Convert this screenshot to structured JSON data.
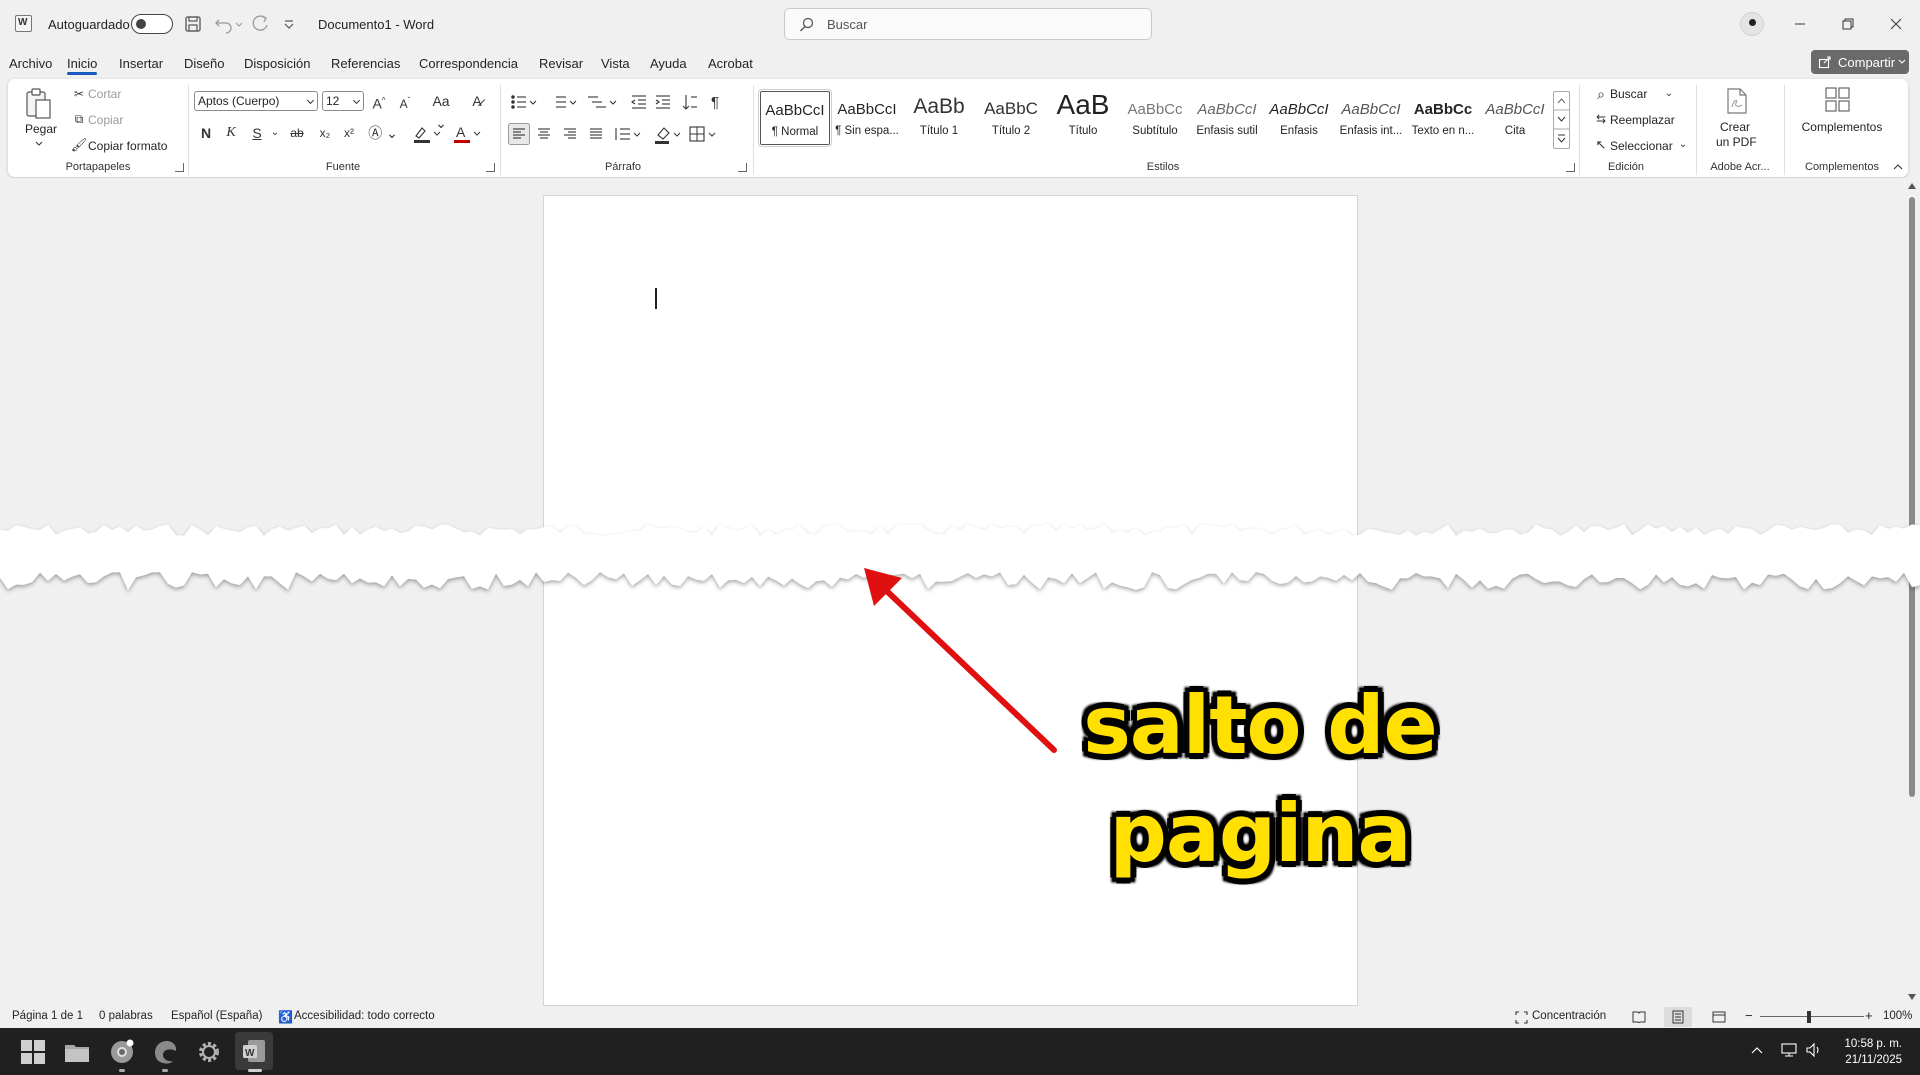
{
  "titlebar": {
    "autosave_label": "Autoguardado",
    "doc_title": "Documento1  -  Word",
    "search_placeholder": "Buscar"
  },
  "menu": {
    "tabs": [
      "Archivo",
      "Inicio",
      "Insertar",
      "Diseño",
      "Disposición",
      "Referencias",
      "Correspondencia",
      "Revisar",
      "Vista",
      "Ayuda",
      "Acrobat"
    ],
    "active_tab": "Inicio",
    "share_label": "Compartir"
  },
  "ribbon": {
    "clipboard": {
      "paste_label": "Pegar",
      "cut_label": "Cortar",
      "copy_label": "Copiar",
      "format_painter_label": "Copiar formato",
      "group_label": "Portapapeles"
    },
    "font": {
      "font_name": "Aptos (Cuerpo)",
      "font_size": "12",
      "case_label": "Aa",
      "bold": "N",
      "italic": "K",
      "underline": "S",
      "strike": "ab",
      "subscript": "x₂",
      "superscript": "x²",
      "group_label": "Fuente"
    },
    "paragraph": {
      "group_label": "Párrafo"
    },
    "styles": {
      "items": [
        {
          "sample": "AaBbCcI",
          "name": "¶ Normal"
        },
        {
          "sample": "AaBbCcI",
          "name": "¶ Sin espa..."
        },
        {
          "sample": "AaBb",
          "name": "Título 1"
        },
        {
          "sample": "AaBbC",
          "name": "Título 2"
        },
        {
          "sample": "AaB",
          "name": "Título"
        },
        {
          "sample": "AaBbCc",
          "name": "Subtítulo"
        },
        {
          "sample": "AaBbCcI",
          "name": "Énfasis sutil"
        },
        {
          "sample": "AaBbCcI",
          "name": "Énfasis"
        },
        {
          "sample": "AaBbCcI",
          "name": "Énfasis int..."
        },
        {
          "sample": "AaBbCc",
          "name": "Texto en n..."
        },
        {
          "sample": "AaBbCcI",
          "name": "Cita"
        }
      ],
      "group_label": "Estilos"
    },
    "editing": {
      "find_label": "Buscar",
      "replace_label": "Reemplazar",
      "select_label": "Seleccionar",
      "group_label": "Edición"
    },
    "adobe": {
      "create_pdf_line1": "Crear",
      "create_pdf_line2": "un PDF",
      "group_label": "Adobe Acr..."
    },
    "addins": {
      "label": "Complementos",
      "group_label": "Complementos"
    }
  },
  "annotation": {
    "line1": "salto de",
    "line2": "pagina",
    "text_color": "#ffe000",
    "arrow_color": "#e01010"
  },
  "status": {
    "page": "Página 1 de 1",
    "words": "0 palabras",
    "language": "Español (España)",
    "accessibility": "Accesibilidad: todo correcto",
    "focus": "Concentración",
    "zoom": "100%"
  },
  "taskbar": {
    "time": "10:58 p. m.",
    "date": "21/11/2025"
  },
  "colors": {
    "accent": "#185abd",
    "taskbar": "#202020",
    "page": "#ffffff",
    "canvas": "#f0f0f0"
  }
}
